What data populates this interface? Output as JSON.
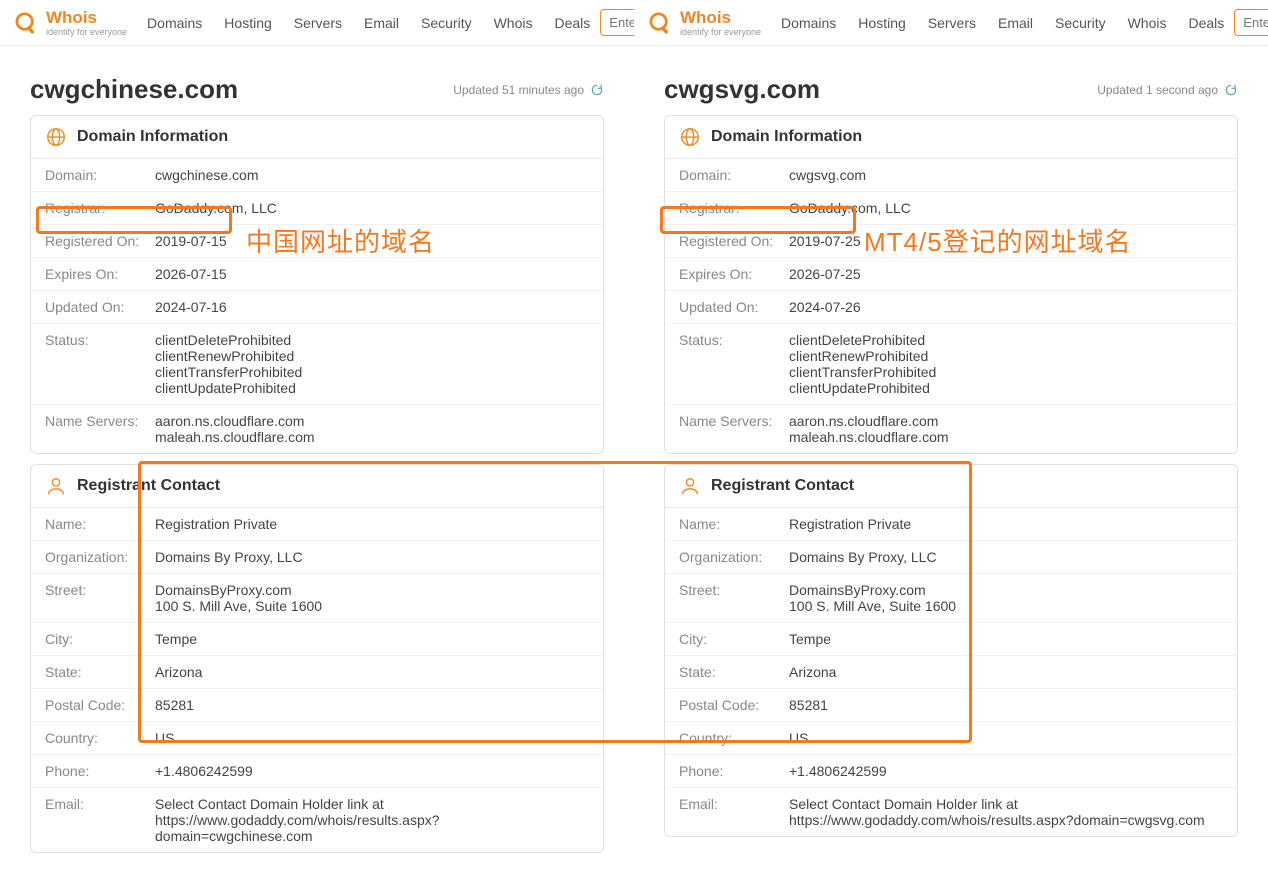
{
  "brand": {
    "name": "Whois",
    "tagline": "identify for everyone"
  },
  "nav": [
    "Domains",
    "Hosting",
    "Servers",
    "Email",
    "Security",
    "Whois",
    "Deals"
  ],
  "search_placeholder": "Enter Domain",
  "panels": [
    {
      "domain": "cwgchinese.com",
      "updated": "Updated 51 minutes ago",
      "info_title": "Domain Information",
      "info": {
        "Domain:": "cwgchinese.com",
        "Registrar:": "GoDaddy.com, LLC",
        "Registered On:": "2019-07-15",
        "Expires On:": "2026-07-15",
        "Updated On:": "2024-07-16",
        "Status:": "clientDeleteProhibited\nclientRenewProhibited\nclientTransferProhibited\nclientUpdateProhibited",
        "Name Servers:": "aaron.ns.cloudflare.com\nmaleah.ns.cloudflare.com"
      },
      "contact_title": "Registrant Contact",
      "contact": {
        "Name:": "Registration Private",
        "Organization:": "Domains By Proxy, LLC",
        "Street:": "DomainsByProxy.com\n100 S. Mill Ave, Suite 1600",
        "City:": "Tempe",
        "State:": "Arizona",
        "Postal Code:": "85281",
        "Country:": "US",
        "Phone:": "+1.4806242599",
        "Email:": "Select Contact Domain Holder link at https://www.godaddy.com/whois/results.aspx?domain=cwgchinese.com"
      }
    },
    {
      "domain": "cwgsvg.com",
      "updated": "Updated 1 second ago",
      "info_title": "Domain Information",
      "info": {
        "Domain:": "cwgsvg.com",
        "Registrar:": "GoDaddy.com, LLC",
        "Registered On:": "2019-07-25",
        "Expires On:": "2026-07-25",
        "Updated On:": "2024-07-26",
        "Status:": "clientDeleteProhibited\nclientRenewProhibited\nclientTransferProhibited\nclientUpdateProhibited",
        "Name Servers:": "aaron.ns.cloudflare.com\nmaleah.ns.cloudflare.com"
      },
      "contact_title": "Registrant Contact",
      "contact": {
        "Name:": "Registration Private",
        "Organization:": "Domains By Proxy, LLC",
        "Street:": "DomainsByProxy.com\n100 S. Mill Ave, Suite 1600",
        "City:": "Tempe",
        "State:": "Arizona",
        "Postal Code:": "85281",
        "Country:": "US",
        "Phone:": "+1.4806242599",
        "Email:": "Select Contact Domain Holder link at https://www.godaddy.com/whois/results.aspx?domain=cwgsvg.com"
      }
    }
  ],
  "annotations": {
    "left_text": "中国网址的域名",
    "right_text": "MT4/5登记的网址域名"
  }
}
